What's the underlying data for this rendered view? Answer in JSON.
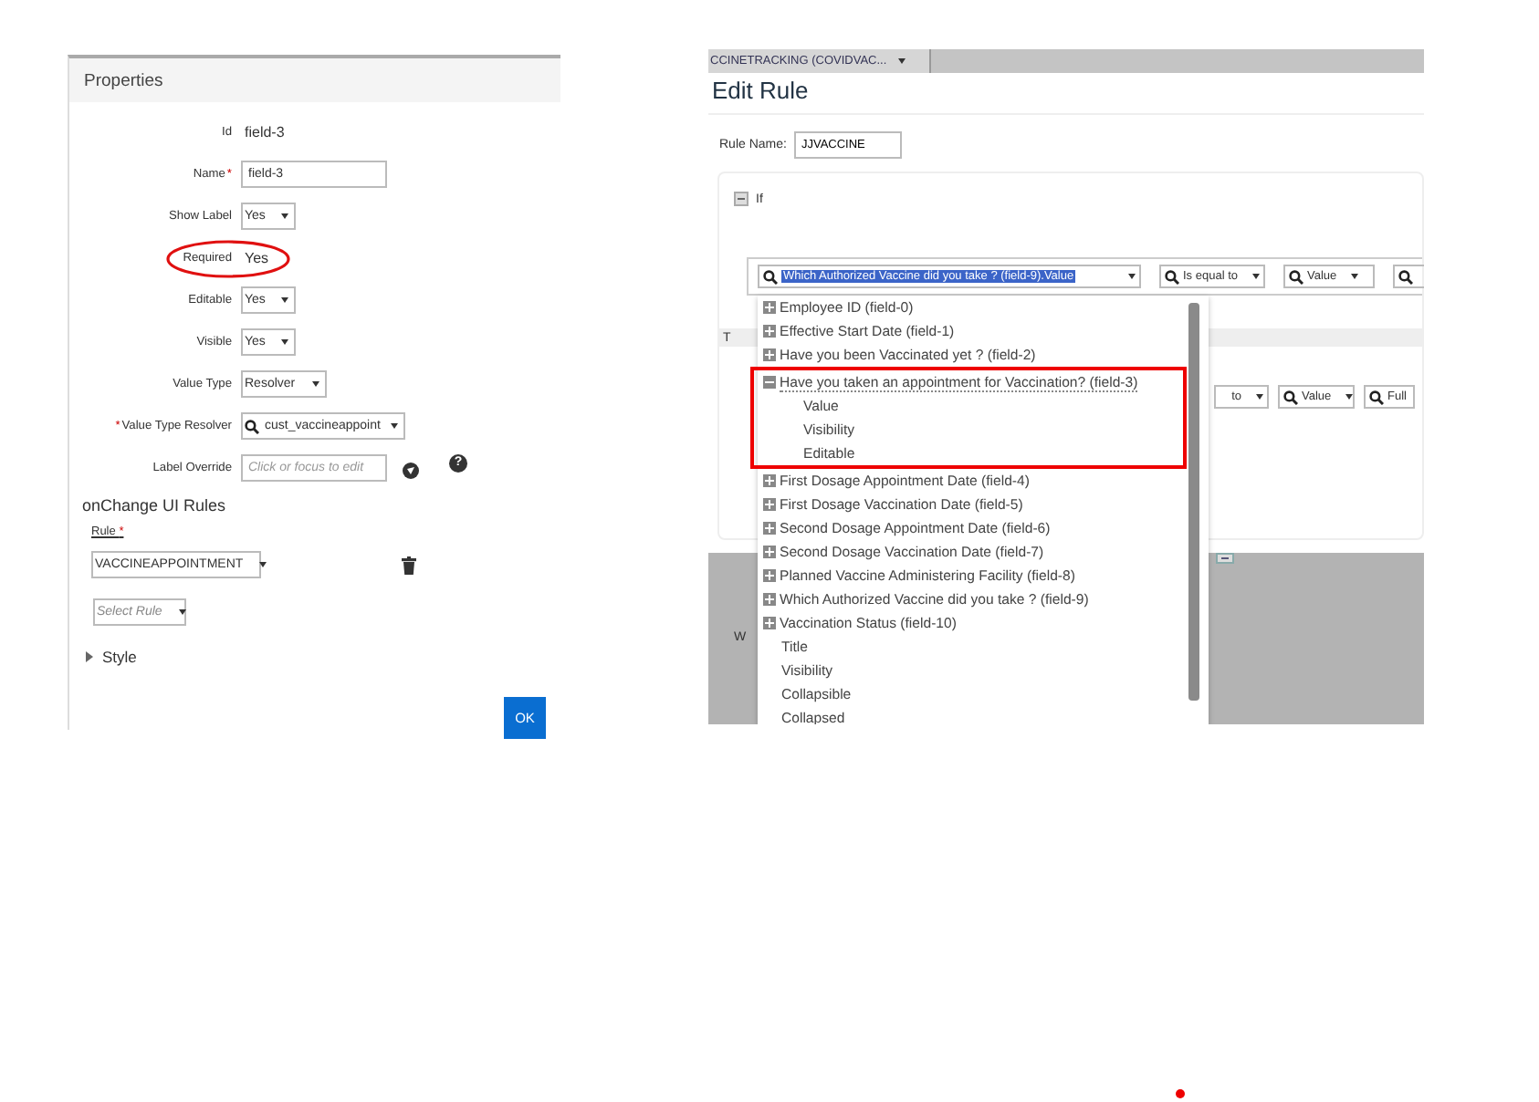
{
  "properties_panel": {
    "title": "Properties",
    "fields": [
      {
        "label": "Id",
        "kind": "text",
        "value": "field-3"
      },
      {
        "label": "Name",
        "suffix_mark": "*",
        "kind": "input",
        "value": "field-3"
      },
      {
        "label": "Show Label",
        "kind": "select",
        "value": "Yes"
      },
      {
        "label": "Required",
        "kind": "text",
        "value": "Yes",
        "circled": true
      },
      {
        "label": "Editable",
        "kind": "select",
        "value": "Yes"
      },
      {
        "label": "Visible",
        "kind": "select",
        "value": "Yes"
      },
      {
        "label": "Value Type",
        "kind": "select",
        "value": "Resolver"
      },
      {
        "label": "Value Type Resolver",
        "prefix_mark": "*",
        "kind": "search-select",
        "value": "cust_vaccineappoint"
      },
      {
        "label": "Label Override",
        "kind": "input",
        "placeholder": "Click or focus to edit",
        "help": "?"
      }
    ],
    "section_title": "onChange UI Rules",
    "rule_label": "Rule",
    "rule_mark": "*",
    "rule_select": "VACCINEAPPOINTMENT",
    "add_rule": {
      "placeholder": "Select Rule"
    },
    "style_section": {
      "label": "Style",
      "expanded": false
    },
    "ok_button": "OK"
  },
  "edit_rule": {
    "context_select": "CCINETRACKING (COVIDVAC...",
    "title": "Edit Rule",
    "rule_name_label": "Rule Name:",
    "rule_name": "JJVACCINE",
    "if_label": "If",
    "condition": {
      "field": "Which Authorized Vaccine did you take ? (field-9).Value",
      "operator": "Is equal to",
      "value_type": "Value"
    },
    "row_2": {
      "column_1": "T",
      "operator": "to",
      "value_type": "Value",
      "column_4": "Full"
    },
    "column_w": "W",
    "dropdown": [
      {
        "label": "Employee ID (field-0)",
        "kind": "field",
        "expanded": false,
        "highlighted": false
      },
      {
        "label": "Effective Start Date (field-1)",
        "kind": "field",
        "expanded": false,
        "highlighted": false
      },
      {
        "label": "Have you been Vaccinated yet ? (field-2)",
        "kind": "field",
        "expanded": false,
        "highlighted": false
      },
      {
        "label": "Have you taken an appointment for Vaccination? (field-3)",
        "kind": "field",
        "expanded": true,
        "highlighted": true,
        "children": [
          {
            "label": "Value"
          },
          {
            "label": "Visibility"
          },
          {
            "label": "Editable"
          }
        ]
      },
      {
        "label": "First Dosage Appointment Date (field-4)",
        "kind": "field",
        "expanded": false,
        "highlighted": false
      },
      {
        "label": "First Dosage Vaccination Date (field-5)",
        "kind": "field",
        "expanded": false,
        "highlighted": false
      },
      {
        "label": "Second Dosage Appointment Date (field-6)",
        "kind": "field",
        "expanded": false,
        "highlighted": false
      },
      {
        "label": "Second Dosage Vaccination Date (field-7)",
        "kind": "field",
        "expanded": false,
        "highlighted": false
      },
      {
        "label": "Planned Vaccine Administering Facility (field-8)",
        "kind": "field",
        "expanded": false,
        "highlighted": false
      },
      {
        "label": "Which Authorized Vaccine did you take ? (field-9)",
        "kind": "field",
        "expanded": false,
        "highlighted": false
      },
      {
        "label": "Vaccination Status (field-10)",
        "kind": "field",
        "expanded": false,
        "highlighted": false
      },
      {
        "label": "Title",
        "kind": "property"
      },
      {
        "label": "Visibility",
        "kind": "property"
      },
      {
        "label": "Collapsible",
        "kind": "property"
      },
      {
        "label": "Collapsed",
        "kind": "property"
      }
    ]
  }
}
